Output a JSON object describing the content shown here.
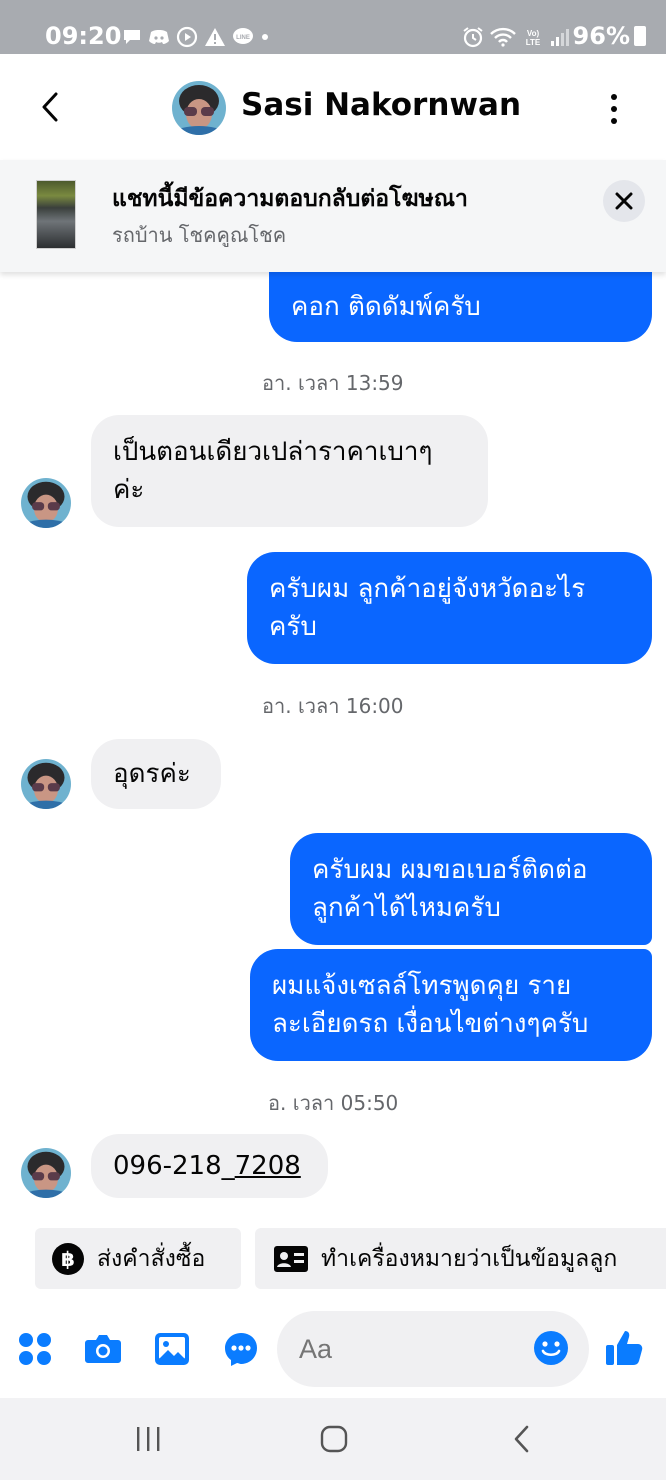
{
  "status_bar": {
    "time": "09:20",
    "battery": "96%",
    "left_icons": [
      "chat-bubble-icon",
      "discord-icon",
      "play-circle-icon",
      "warning-icon",
      "line-icon",
      "dot-icon"
    ],
    "right_icons": [
      "alarm-icon",
      "wifi-icon",
      "volte-icon",
      "signal-icon",
      "battery-icon"
    ]
  },
  "header": {
    "contact_name": "Sasi Nakornwan"
  },
  "ad_banner": {
    "title": "แชทนี้มีข้อความตอบกลับต่อโฆษณา",
    "subtitle": "รถบ้าน โชคคูณโชค"
  },
  "messages": [
    {
      "type": "outgoing",
      "text": "คอก ติดดัมพ์ครับ",
      "partial": true
    },
    {
      "type": "timestamp",
      "text": "อา. เวลา 13:59"
    },
    {
      "type": "incoming",
      "line1": "เป็นตอนเดียวเปล่าราคาเบาๆ",
      "line2": "ค่ะ"
    },
    {
      "type": "outgoing",
      "line1": "ครับผม ลูกค้าอยู่จังหวัดอะไร",
      "line2": "ครับ"
    },
    {
      "type": "timestamp",
      "text": "อา. เวลา 16:00"
    },
    {
      "type": "incoming",
      "text": "อุดรค่ะ"
    },
    {
      "type": "outgoing",
      "line1": "ครับผม ผมขอเบอร์ติดต่อ",
      "line2": "ลูกค้าได้ไหมครับ"
    },
    {
      "type": "outgoing",
      "line1": "ผมแจ้งเซลล์โทรพูดคุย ราย",
      "line2": "ละเอียดรถ เงื่อนไขต่างๆครับ"
    },
    {
      "type": "timestamp",
      "text": "อ. เวลา 05:50"
    },
    {
      "type": "incoming",
      "text_prefix": "096-218_",
      "text_link": "7208"
    }
  ],
  "quick_actions": [
    {
      "label": "ส่งคำสั่งซื้อ",
      "icon": "baht-icon"
    },
    {
      "label": "ทำเครื่องหมายว่าเป็นข้อมูลลูก",
      "icon": "contact-card-icon"
    }
  ],
  "composer": {
    "placeholder": "Aa"
  },
  "colors": {
    "outgoing_bubble": "#0a66ff",
    "incoming_bubble": "#f0f0f2",
    "accent": "#0a7cff"
  }
}
